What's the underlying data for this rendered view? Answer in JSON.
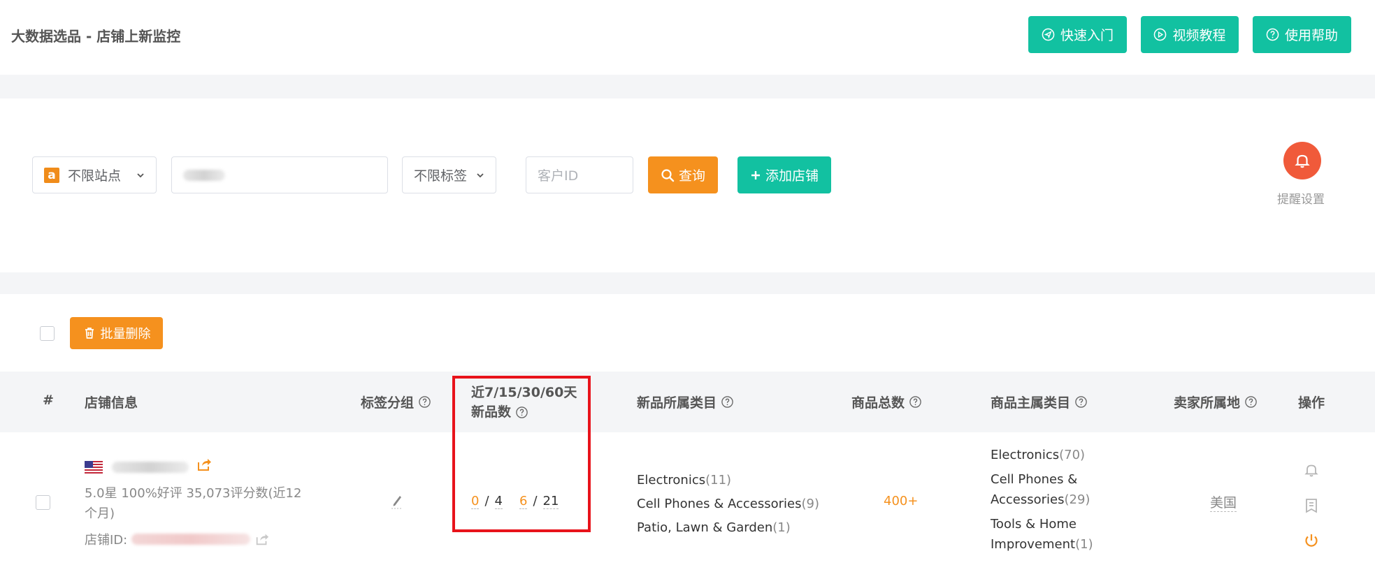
{
  "header": {
    "title": "大数据选品 - 店铺上新监控",
    "buttons": {
      "quickstart": "快速入门",
      "video": "视频教程",
      "help": "使用帮助"
    }
  },
  "filters": {
    "site_select": "不限站点",
    "tag_select": "不限标签",
    "customer_id_placeholder": "客户ID",
    "search_button": "查询",
    "add_store_button": "添加店铺",
    "reminder_label": "提醒设置"
  },
  "table": {
    "bulk_delete": "批量删除",
    "columns": {
      "index": "#",
      "store_info": "店铺信息",
      "tag_group": "标签分组",
      "new_count_line1": "近7/15/30/60天",
      "new_count_line2": "新品数",
      "new_categories": "新品所属类目",
      "total_products": "商品总数",
      "main_categories": "商品主属类目",
      "seller_location": "卖家所属地",
      "actions": "操作"
    },
    "rows": [
      {
        "rating_line1": "5.0星  100%好评  35,073评分数(近12",
        "rating_line2": "个月)",
        "store_id_label": "店铺ID:",
        "new_counts": {
          "d7": "0",
          "d15": "4",
          "d30": "6",
          "d60": "21"
        },
        "new_categories": [
          {
            "name": "Electronics",
            "count": "(11)"
          },
          {
            "name": "Cell Phones & Accessories",
            "count": "(9)"
          },
          {
            "name": "Patio, Lawn & Garden",
            "count": "(1)"
          }
        ],
        "total_products": "400+",
        "main_categories": [
          {
            "name": "Electronics",
            "count": "(70)"
          },
          {
            "name": "Cell Phones &",
            "name2": "Accessories",
            "count": "(29)"
          },
          {
            "name": "Tools & Home",
            "name2": "Improvement",
            "count": "(1)"
          }
        ],
        "seller_location": "美国"
      }
    ]
  },
  "colors": {
    "teal": "#12c1a1",
    "orange": "#f5911e",
    "red_box": "#e8131b",
    "bell": "#f05a3a"
  }
}
